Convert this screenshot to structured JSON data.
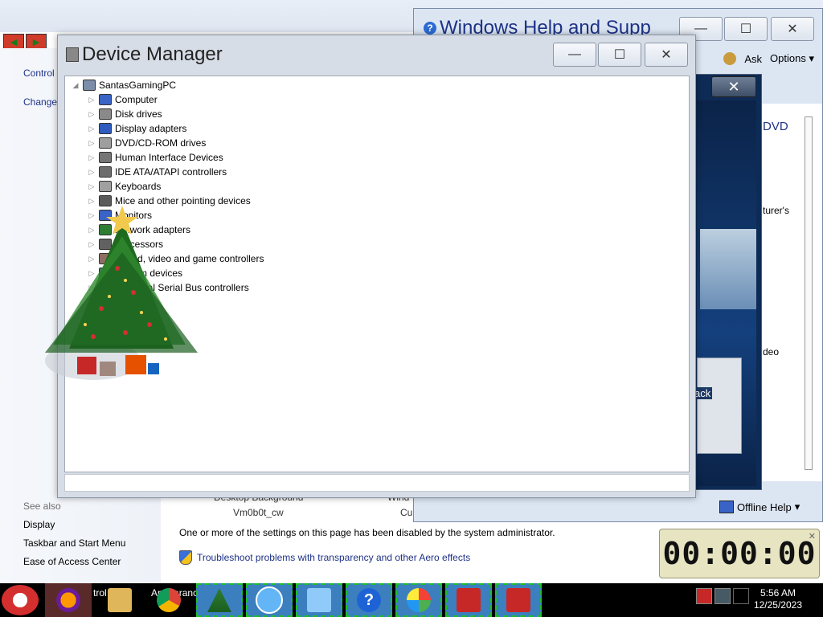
{
  "control_panel": {
    "sidebar_links": [
      "Control",
      "Change"
    ],
    "see_also_label": "See also",
    "see_also_links": [
      "Display",
      "Taskbar and Start Menu",
      "Ease of Access Center"
    ],
    "bottom_labels": [
      "Desktop Background",
      "Vm0b0t_cw",
      "Wind",
      "Cu"
    ],
    "notice": "One or more of the settings on this page has been disabled by the system administrator.",
    "troubleshoot_link": "Troubleshoot problems with transparency and other Aero effects"
  },
  "help_window": {
    "title": "Windows Help and Supp",
    "toolbar": [
      "Ask",
      "Options"
    ],
    "content_fragments": [
      "DVD",
      "turer's",
      "deo"
    ],
    "bottom_label": "Offline Help",
    "min_glyph": "—",
    "max_glyph": "☐",
    "close_glyph": "✕"
  },
  "media_window": {
    "close_glyph": "✕",
    "panel_label": "ack"
  },
  "device_manager": {
    "title": "Device Manager",
    "min_glyph": "—",
    "max_glyph": "☐",
    "close_glyph": "✕",
    "root": "SantasGamingPC",
    "items": [
      {
        "label": "Computer",
        "icon_color": "#3a63c6"
      },
      {
        "label": "Disk drives",
        "icon_color": "#8a8a8a"
      },
      {
        "label": "Display adapters",
        "icon_color": "#2f5bbf"
      },
      {
        "label": "DVD/CD-ROM drives",
        "icon_color": "#9e9e9e"
      },
      {
        "label": "Human Interface Devices",
        "icon_color": "#757575"
      },
      {
        "label": "IDE ATA/ATAPI controllers",
        "icon_color": "#6d6d6d"
      },
      {
        "label": "Keyboards",
        "icon_color": "#a0a0a0"
      },
      {
        "label": "Mice and other pointing devices",
        "icon_color": "#5a5a5a"
      },
      {
        "label": "Monitors",
        "icon_color": "#3a63c6"
      },
      {
        "label": "Network adapters",
        "icon_color": "#2e7d32"
      },
      {
        "label": "Processors",
        "icon_color": "#616161"
      },
      {
        "label": "Sound, video and game controllers",
        "icon_color": "#8d6e63"
      },
      {
        "label": "System devices",
        "icon_color": "#546e7a"
      },
      {
        "label": "Universal Serial Bus controllers",
        "icon_color": "#455a64"
      }
    ]
  },
  "clock": {
    "display": "00:00:00",
    "close_glyph": "✕"
  },
  "taskbar": {
    "labels": [
      "trol",
      "Appearanc"
    ],
    "time": "5:56 AM",
    "date": "12/25/2023"
  },
  "colors": {
    "link": "#1e3287",
    "festive_border": "#1cbf2a"
  }
}
